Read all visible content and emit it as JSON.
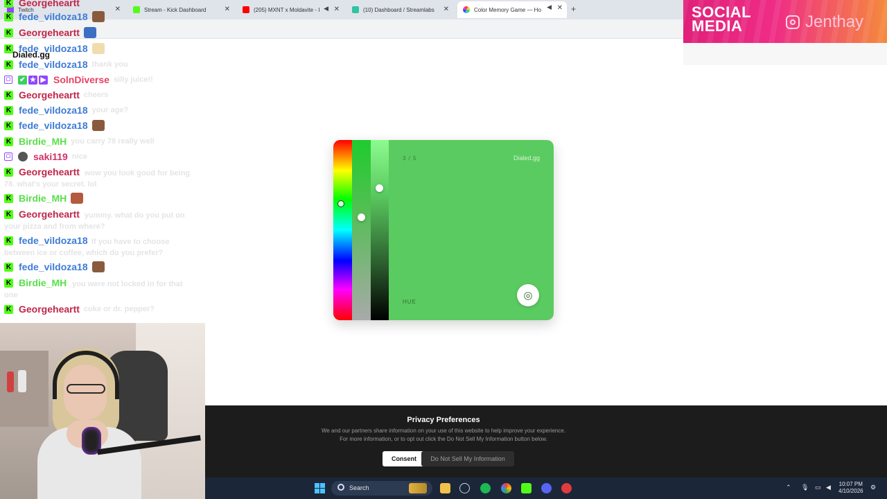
{
  "browser": {
    "tabs": [
      {
        "label": "Twitch",
        "color": "#9146ff"
      },
      {
        "label": "Stream - Kick Dashboard",
        "color": "#53fc18"
      },
      {
        "label": "(205) MXNT x Moldavite - I",
        "color": "#ff0000"
      },
      {
        "label": "(10) Dashboard / Streamlabs",
        "color": "#31c3a2"
      },
      {
        "label": "Color Memory Game — Ho",
        "color": "#f08a24"
      }
    ],
    "new_tab": "+",
    "close": "✕"
  },
  "overlay_banner": {
    "title_line1": "SOCIAL",
    "title_line2": "MEDIA",
    "handle": "Jenthay",
    "icon": "instagram-icon"
  },
  "dialed_overlay": "Dialed.gg",
  "chat": {
    "messages": [
      {
        "name": "Georgeheartt",
        "text": "",
        "badge": "kick",
        "color": "george"
      },
      {
        "name": "fede_vildoza18",
        "text": "",
        "badge": "kick",
        "color": "fede"
      },
      {
        "name": "Georgeheartt",
        "text": "",
        "badge": "kick",
        "color": "george"
      },
      {
        "name": "fede_vildoza18",
        "text": "",
        "badge": "kick",
        "color": "fede"
      },
      {
        "name": "fede_vildoza18",
        "text": "thank you",
        "badge": "kick",
        "color": "fede"
      },
      {
        "name": "SolnDiverse",
        "text": "silly juice!!",
        "badge": "twitch",
        "color": "soln"
      },
      {
        "name": "Georgeheartt",
        "text": "cheers",
        "badge": "kick",
        "color": "george"
      },
      {
        "name": "fede_vildoza18",
        "text": "your age?",
        "badge": "kick",
        "color": "fede"
      },
      {
        "name": "fede_vildoza18",
        "text": "",
        "badge": "kick",
        "color": "fede"
      },
      {
        "name": "Birdie_MH",
        "text": "you carry 78 really well",
        "badge": "kick",
        "color": "birdie"
      },
      {
        "name": "saki119",
        "text": "nice",
        "badge": "twitch",
        "color": "saki"
      },
      {
        "name": "Georgeheartt",
        "text": "wow you look good for being 78. what's your secret. lol",
        "badge": "kick",
        "color": "george"
      },
      {
        "name": "Birdie_MH",
        "text": "",
        "badge": "kick",
        "color": "birdie"
      },
      {
        "name": "Georgeheartt",
        "text": "yummy. what do you put on your pizza and from where?",
        "badge": "kick",
        "color": "george"
      },
      {
        "name": "fede_vildoza18",
        "text": "If you have to choose between ice or coffee, which do you prefer?",
        "badge": "kick",
        "color": "fede"
      },
      {
        "name": "fede_vildoza18",
        "text": "",
        "badge": "kick",
        "color": "fede"
      },
      {
        "name": "Birdie_MH",
        "text": "you were not locked in for that one",
        "badge": "kick",
        "color": "birdie"
      },
      {
        "name": "Georgeheartt",
        "text": "coke or dr. pepper?",
        "badge": "kick",
        "color": "george"
      }
    ]
  },
  "game": {
    "counter": "3 / 5",
    "brand": "Dialed.gg",
    "hue_label": "HUE",
    "current_color": "#5acb60",
    "submit_icon": "target-icon"
  },
  "privacy": {
    "title": "Privacy Preferences",
    "body_line1": "We and our partners share information on your use of this website to help improve your experience.",
    "body_line2": "For more information, or to opt out click the Do Not Sell My Information button below.",
    "consent": "Consent",
    "do_not_sell": "Do Not Sell My Information"
  },
  "taskbar": {
    "search_placeholder": "Search",
    "time": "10:07 PM",
    "date": "4/10/2026"
  }
}
